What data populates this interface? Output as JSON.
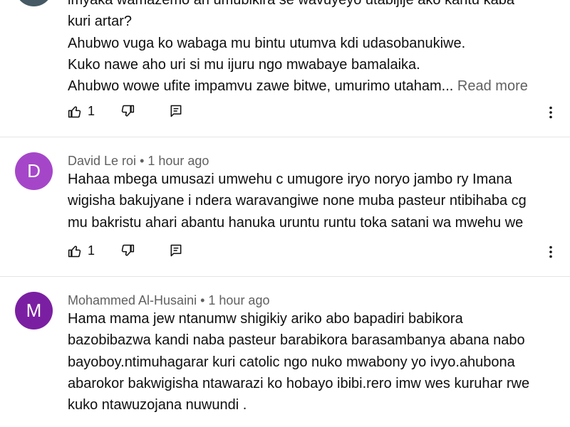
{
  "comment1": {
    "lines": [
      "imyaka wamazemo ari umubikira se wavuyeyo utabijije ako kantu kaba",
      "kuri artar?",
      "Ahubwo vuga ko wabaga mu bintu utumva kdi udasobanukiwe.",
      "Kuko nawe aho uri si mu ijuru ngo mwabaye bamalaika.",
      "Ahubwo wowe ufite impamvu zawe bitwe, umurimo utaham..."
    ],
    "read_more": "Read more",
    "like_count": "1"
  },
  "comment2": {
    "avatar_letter": "D",
    "author": "David Le roi",
    "time": "• 1 hour ago",
    "lines": [
      "Hahaa mbega umusazi umwehu c umugore iryo noryo jambo ry Imana",
      "wigisha bakujyane i ndera waravangiwe none muba pasteur ntibihaba cg",
      "mu bakristu ahari abantu hanuka uruntu runtu toka satani wa mwehu we"
    ],
    "like_count": "1"
  },
  "comment3": {
    "avatar_letter": "M",
    "author": "Mohammed Al-Husaini",
    "time": "• 1 hour ago",
    "lines": [
      "Hama mama jew ntanumw shigikiy ariko abo bapadiri babikora",
      "bazobibazwa kandi naba pasteur barabikora barasambanya abana nabo",
      "bayoboy.ntimuhagarar kuri catolic ngo nuko mwabony yo ivyo.ahubona",
      "abarokor bakwigisha ntawarazi ko hobayo ibibi.rero imw wes kuruhar rwe",
      "kuko ntawuzojana nuwundi ."
    ]
  },
  "colors": {
    "avatar_d": "#a546c9",
    "avatar_m": "#7b1fa2",
    "avatar_top": "#455a64",
    "secondary_text": "#606060",
    "divider": "#e5e5e5"
  },
  "icons": {
    "like": "thumb-up-icon",
    "dislike": "thumb-down-icon",
    "reply": "reply-comment-icon",
    "more": "more-vert-icon"
  }
}
